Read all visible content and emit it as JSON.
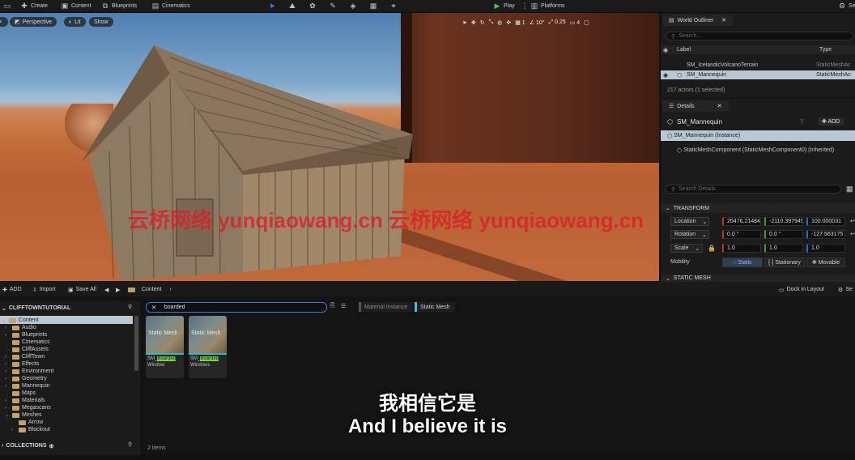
{
  "toolbar": {
    "create": "Create",
    "content": "Content",
    "blueprints": "Blueprints",
    "cinematics": "Cinematics",
    "play": "Play",
    "platforms": "Platforms",
    "settings": "Se"
  },
  "viewport": {
    "perspective": "Perspective",
    "lit": "Lit",
    "show": "Show",
    "grid_value": "1",
    "angle_value": "10°",
    "scale_value": "0.25",
    "camera_speed": "4",
    "watermark": "云桥网络 yunqiaowang.cn 云桥网络 yunqiaowang.cn"
  },
  "outliner": {
    "tab": "World Outliner",
    "search_placeholder": "Search...",
    "col_label": "Label",
    "col_type": "Type",
    "rows": [
      {
        "label": "SM_IcelandicVolcanoTerrain",
        "type": "StaticMeshAc"
      },
      {
        "label": "SM_Mannequin",
        "type": "StaticMeshAc"
      }
    ],
    "status": "217 actors (1 selected)"
  },
  "details": {
    "tab": "Details",
    "object_name": "SM_Mannequin",
    "add": "ADD",
    "instance": "SM_Mannequin (Instance)",
    "component": "StaticMeshComponent (StaticMeshComponent0) (Inherited)",
    "search_placeholder": "Search Details",
    "transform_header": "TRANSFORM",
    "location_label": "Location",
    "location": [
      "20476.214844",
      "-2110.397949",
      "100.000031"
    ],
    "rotation_label": "Rotation",
    "rotation": [
      "0.0 °",
      "0.0 °",
      "-127.563175"
    ],
    "scale_label": "Scale",
    "scale": [
      "1.0",
      "1.0",
      "1.0"
    ],
    "mobility_label": "Mobility",
    "mobility_options": [
      "Static",
      "Stationary",
      "Movable"
    ],
    "static_mesh_header": "STATIC MESH"
  },
  "content_browser": {
    "add": "ADD",
    "import": "Import",
    "save_all": "Save All",
    "path": "Content",
    "dock": "Dock in Layout",
    "settings": "Se",
    "project": "CLIFFTOWNTUTORIAL",
    "search_value": "boarded",
    "filters": [
      "Material Instance",
      "Static Mesh"
    ],
    "tree": [
      "Content",
      "Audio",
      "Blueprints",
      "Cinematics",
      "CliffAssets",
      "CliffTown",
      "Effects",
      "Environment",
      "Geometry",
      "Mannequin",
      "Maps",
      "Materials",
      "Megascans",
      "Meshes",
      "Arrow",
      "Blockout"
    ],
    "collections": "COLLECTIONS",
    "items_count": "2 items",
    "assets": [
      {
        "type": "Static Mesh",
        "name_prefix": "SM_",
        "name_highlight": "Boarded",
        "name_suffix": "Window"
      },
      {
        "type": "Static Mesh",
        "name_prefix": "SM_",
        "name_highlight": "Boarded",
        "name_suffix": "Windows"
      }
    ]
  },
  "subtitles": {
    "chinese": "我相信它是",
    "english": "And I believe it is"
  },
  "colors": {
    "accent_cyan": "#38b7c9",
    "selected_row": "#b8c7d1",
    "highlight_green": "#7bd342",
    "watermark_red": "#dc1e28"
  }
}
